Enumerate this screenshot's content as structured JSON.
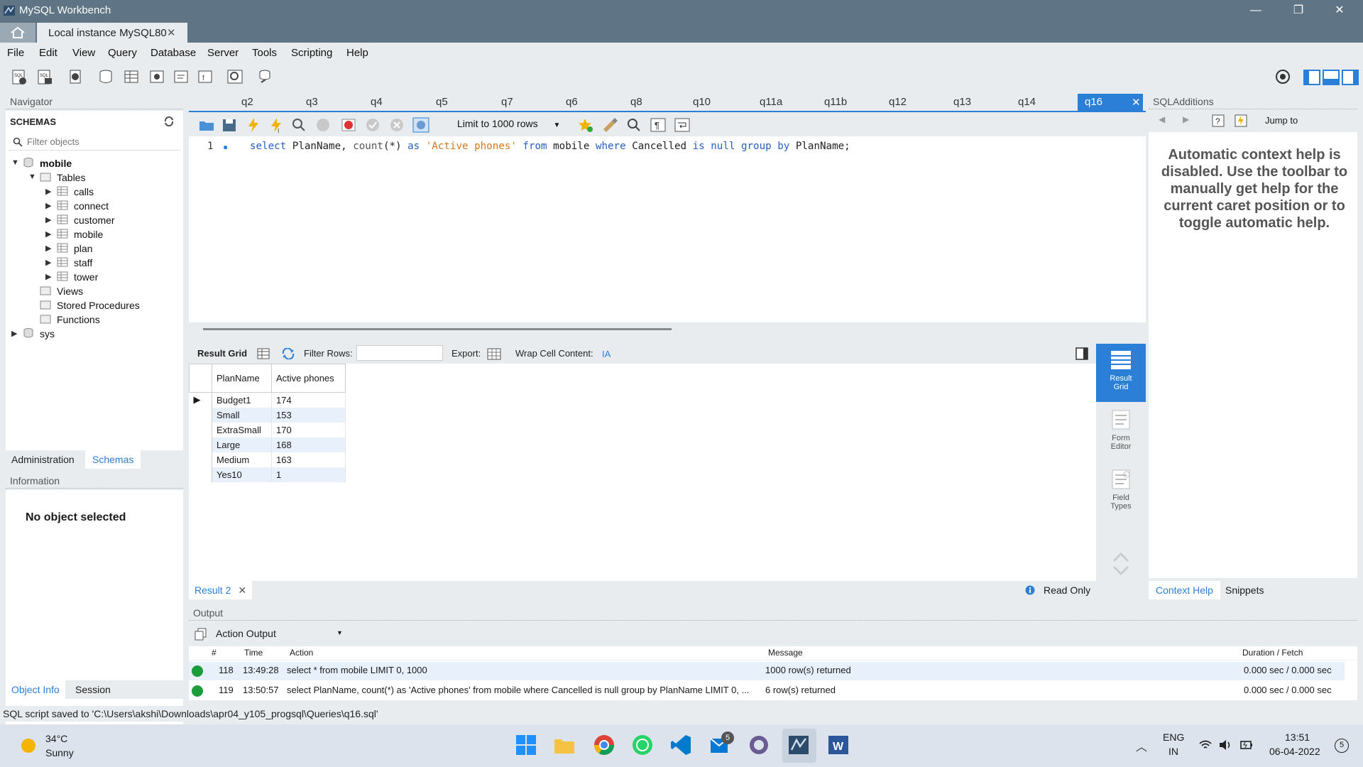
{
  "window": {
    "title": "MySQL Workbench",
    "controls": [
      "—",
      "❐",
      "✕"
    ]
  },
  "connection_tab": {
    "label": "Local instance MySQL80",
    "close": "✕"
  },
  "menu": [
    "File",
    "Edit",
    "View",
    "Query",
    "Database",
    "Server",
    "Tools",
    "Scripting",
    "Help"
  ],
  "navigator": {
    "header": "Navigator",
    "schemas_label": "SCHEMAS",
    "filter_placeholder": "Filter objects",
    "tree": {
      "db": "mobile",
      "tables_label": "Tables",
      "tables": [
        "calls",
        "connect",
        "customer",
        "mobile",
        "plan",
        "staff",
        "tower"
      ],
      "views": "Views",
      "procs": "Stored Procedures",
      "funcs": "Functions",
      "other_db": "sys"
    },
    "tabs": [
      "Administration",
      "Schemas"
    ],
    "info_header": "Information",
    "no_object": "No object selected",
    "bottom_tabs": [
      "Object Info",
      "Session"
    ]
  },
  "query_tabs": [
    "q2",
    "q3",
    "q4",
    "q5",
    "q7",
    "q6",
    "q8",
    "q10",
    "q11a",
    "q11b",
    "q12",
    "q13",
    "q14",
    "q16"
  ],
  "active_tab": "q16",
  "editor": {
    "limit": "Limit to 1000 rows",
    "line_number": "1",
    "tokens": [
      {
        "t": "select",
        "c": "kw"
      },
      {
        "t": " PlanName, ",
        "c": ""
      },
      {
        "t": "count",
        "c": "fn"
      },
      {
        "t": "(*) ",
        "c": ""
      },
      {
        "t": "as",
        "c": "kw"
      },
      {
        "t": " ",
        "c": ""
      },
      {
        "t": "'Active phones'",
        "c": "str"
      },
      {
        "t": " ",
        "c": ""
      },
      {
        "t": "from",
        "c": "kw"
      },
      {
        "t": " mobile ",
        "c": ""
      },
      {
        "t": "where",
        "c": "kw"
      },
      {
        "t": " Cancelled ",
        "c": ""
      },
      {
        "t": "is null group by",
        "c": "kw"
      },
      {
        "t": " PlanName;",
        "c": ""
      }
    ]
  },
  "result": {
    "grid_label": "Result Grid",
    "filter_label": "Filter Rows:",
    "export_label": "Export:",
    "wrap_label": "Wrap Cell Content:",
    "columns": [
      "PlanName",
      "Active phones"
    ],
    "rows": [
      [
        "Budget1",
        "174"
      ],
      [
        "Small",
        "153"
      ],
      [
        "ExtraSmall",
        "170"
      ],
      [
        "Large",
        "168"
      ],
      [
        "Medium",
        "163"
      ],
      [
        "Yes10",
        "1"
      ]
    ],
    "side_buttons": [
      {
        "label": "Result Grid",
        "active": true
      },
      {
        "label": "Form Editor",
        "active": false
      },
      {
        "label": "Field Types",
        "active": false
      }
    ],
    "tab": "Result 2",
    "read_only": "Read Only"
  },
  "sql_additions": {
    "header": "SQLAdditions",
    "jump_to": "Jump to",
    "help_text": "Automatic context help is disabled. Use the toolbar to manually get help for the current caret position or to toggle automatic help.",
    "tabs": [
      "Context Help",
      "Snippets"
    ]
  },
  "output": {
    "header": "Output",
    "selector": "Action Output",
    "columns": [
      "#",
      "Time",
      "Action",
      "Message",
      "Duration / Fetch"
    ],
    "rows": [
      {
        "n": "118",
        "time": "13:49:28",
        "action": "select * from mobile LIMIT 0, 1000",
        "message": "1000 row(s) returned",
        "duration": "0.000 sec / 0.000 sec"
      },
      {
        "n": "119",
        "time": "13:50:57",
        "action": "select PlanName, count(*) as 'Active phones' from mobile where Cancelled is null group by PlanName LIMIT 0, ...",
        "message": "6 row(s) returned",
        "duration": "0.000 sec / 0.000 sec"
      }
    ]
  },
  "status": "SQL script saved to 'C:\\Users\\akshi\\Downloads\\apr04_y105_progsql\\Queries\\q16.sql'",
  "taskbar": {
    "temp": "34°C",
    "condition": "Sunny",
    "badge": "5",
    "lang1": "ENG",
    "lang2": "IN",
    "time": "13:51",
    "date": "06-04-2022",
    "notif": "5"
  }
}
